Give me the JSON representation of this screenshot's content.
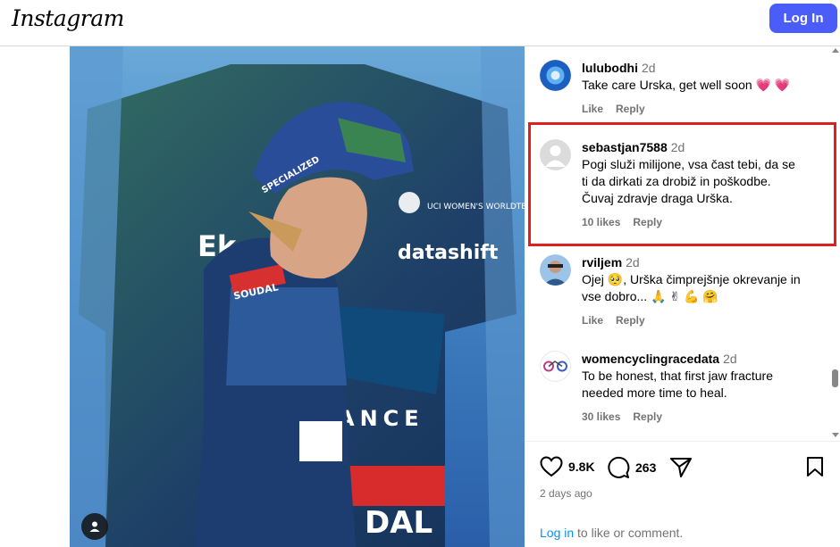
{
  "header": {
    "logo": "Instagram",
    "login_button": "Log In"
  },
  "comments": [
    {
      "username": "lulubodhi",
      "time": "2d",
      "text": "Take care Urska, get well soon 💗 💗",
      "likes": "",
      "like_label": "Like",
      "reply_label": "Reply",
      "avatar_color": "#2a7de1"
    },
    {
      "username": "sebastjan7588",
      "time": "2d",
      "text": "Pogi služi milijone, vsa čast tebi, da se\nti da dirkati za drobiž in poškodbe.\nČuvaj zdravje draga Urška.",
      "likes": "10 likes",
      "like_label": "",
      "reply_label": "Reply",
      "avatar_color": "#c7c7c7"
    },
    {
      "username": "rviljem",
      "time": "2d",
      "text": "Ojej 🥺, Urška čimprejšnje okrevanje in\nvse dobro... 🙏 ✌ 💪 🤗",
      "likes": "",
      "like_label": "Like",
      "reply_label": "Reply",
      "avatar_color": "#8fb3d9"
    },
    {
      "username": "womencyclingracedata",
      "time": "2d",
      "text": "To be honest, that first jaw fracture\nneeded more time to heal.",
      "likes": "30 likes",
      "like_label": "",
      "reply_label": "Reply",
      "avatar_color": "#ffffff"
    }
  ],
  "actions": {
    "likes_count": "9.8K",
    "comments_count": "263"
  },
  "post": {
    "time_ago": "2 days ago"
  },
  "footer": {
    "login_link": "Log in",
    "login_suffix": " to like or comment."
  },
  "photo": {
    "sponsor_text": "datashift",
    "team_text": "UCI WOMEN'S WORLDTEAM",
    "letters_left": "Ek",
    "ance_text": "ANCE",
    "soudal_text": "DAL",
    "jersey_brand": "SOUDAL",
    "helmet_brand": "SPECIALIZED"
  },
  "colors": {
    "accent": "#4a5df9",
    "highlight": "#e02020",
    "link": "#0095f6"
  }
}
